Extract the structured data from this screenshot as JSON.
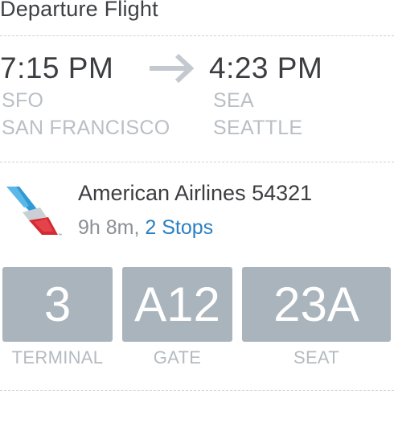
{
  "section": {
    "title": "Departure Flight"
  },
  "departure": {
    "time": "7:15 PM",
    "code": "SFO",
    "city": "SAN FRANCISCO"
  },
  "arrival": {
    "time": "4:23 PM",
    "code": "SEA",
    "city": "SEATTLE"
  },
  "icons": {
    "route_arrow": "arrow-right-icon",
    "airline_logo": "american-airlines-logo-icon"
  },
  "airline": {
    "name_and_flight": "American Airlines 54321",
    "duration": "9h 8m,",
    "stops": "2 Stops"
  },
  "details": {
    "terminal": {
      "value": "3",
      "label": "TERMINAL"
    },
    "gate": {
      "value": "A12",
      "label": "GATE"
    },
    "seat": {
      "value": "23A",
      "label": "SEAT"
    }
  },
  "colors": {
    "box_background": "#a9b4bc",
    "link": "#2a7fc1",
    "muted_text": "#b9bfc5",
    "primary_text": "#3b3d40"
  }
}
